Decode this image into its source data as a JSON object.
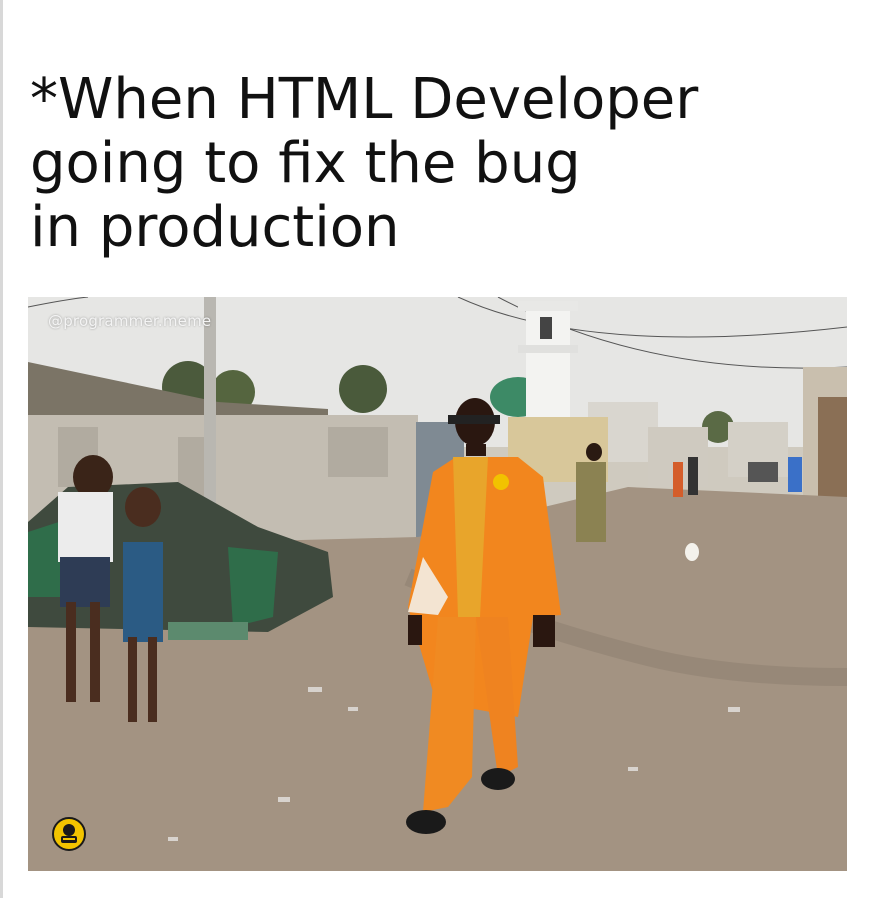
{
  "caption": {
    "lines": [
      "*When HTML Developer",
      "going to fix the bug",
      "in production"
    ]
  },
  "photo": {
    "watermark": "@programmer.meme"
  },
  "colors": {
    "sky": "#e6e6e4",
    "ground": "#a39382",
    "wall": "#c3bdb2",
    "suit": "#f2861e",
    "vest": "#e8a52b",
    "badge": "#f2c400"
  },
  "icons": {
    "badge": "programmer-meme-logo-icon"
  }
}
